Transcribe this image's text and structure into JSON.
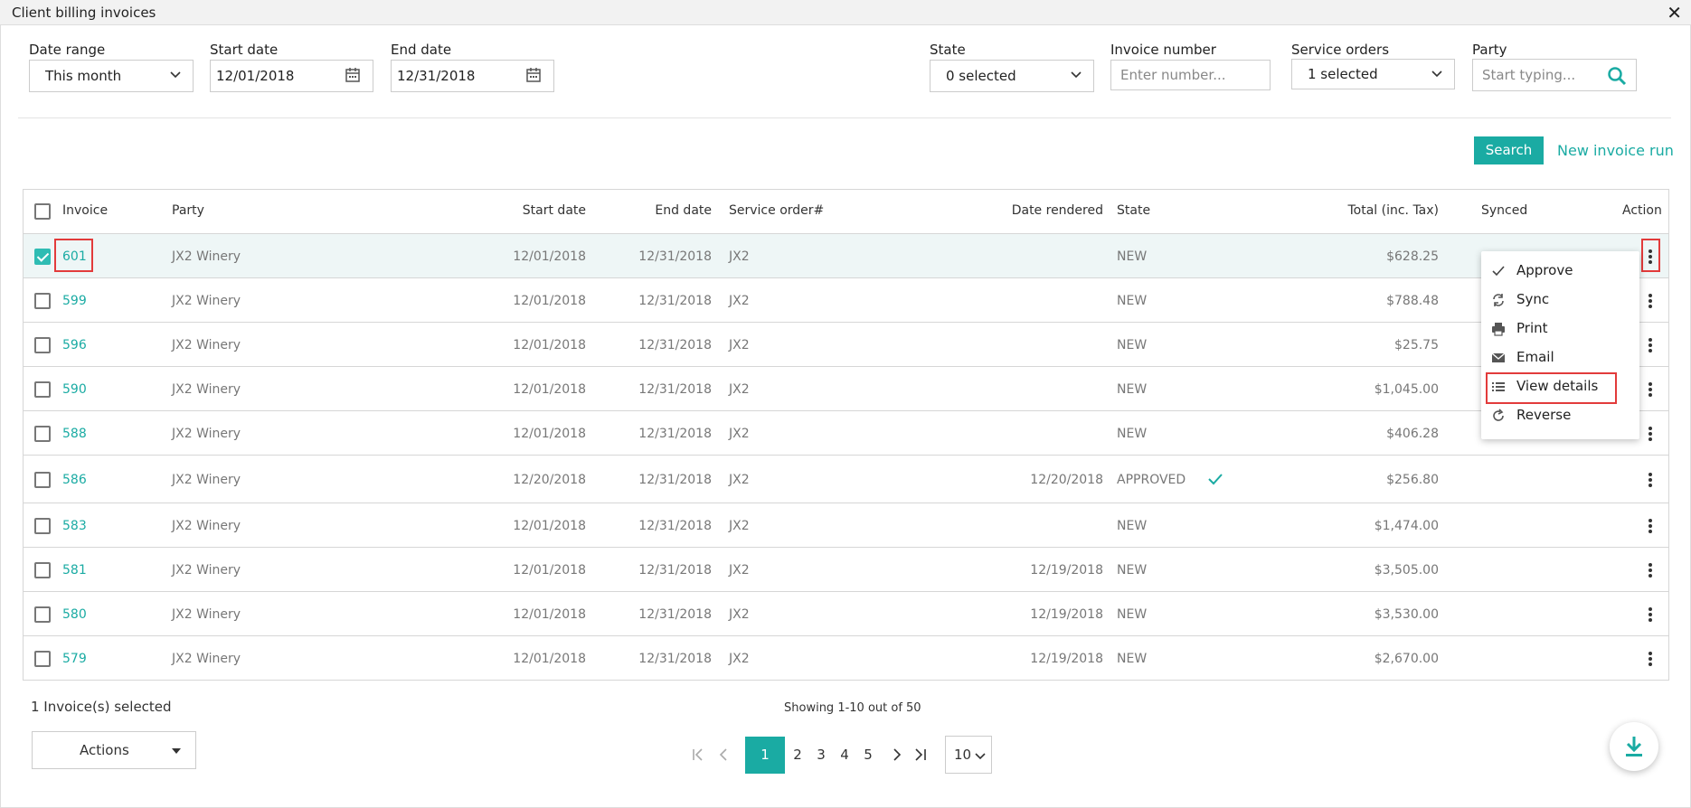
{
  "window": {
    "title": "Client billing invoices"
  },
  "filters": {
    "date_range": {
      "label": "Date range",
      "value": "This month"
    },
    "start_date": {
      "label": "Start date",
      "value": "12/01/2018"
    },
    "end_date": {
      "label": "End date",
      "value": "12/31/2018"
    },
    "state": {
      "label": "State",
      "value": "0 selected"
    },
    "invoice_number": {
      "label": "Invoice number",
      "placeholder": "Enter number..."
    },
    "service_orders": {
      "label": "Service orders",
      "value": "1 selected"
    },
    "party": {
      "label": "Party",
      "placeholder": "Start typing..."
    }
  },
  "toolbar": {
    "search_label": "Search",
    "new_run_label": "New invoice run"
  },
  "table": {
    "headers": {
      "invoice": "Invoice",
      "party": "Party",
      "start_date": "Start date",
      "end_date": "End date",
      "service_order": "Service order#",
      "date_rendered": "Date rendered",
      "state": "State",
      "total": "Total (inc. Tax)",
      "synced": "Synced",
      "action": "Action"
    },
    "rows": [
      {
        "invoice": "601",
        "party": "JX2 Winery",
        "start": "12/01/2018",
        "end": "12/31/2018",
        "so": "JX2",
        "rendered": "",
        "state": "NEW",
        "total": "$628.25",
        "checked": true
      },
      {
        "invoice": "599",
        "party": "JX2 Winery",
        "start": "12/01/2018",
        "end": "12/31/2018",
        "so": "JX2",
        "rendered": "",
        "state": "NEW",
        "total": "$788.48",
        "checked": false
      },
      {
        "invoice": "596",
        "party": "JX2 Winery",
        "start": "12/01/2018",
        "end": "12/31/2018",
        "so": "JX2",
        "rendered": "",
        "state": "NEW",
        "total": "$25.75",
        "checked": false
      },
      {
        "invoice": "590",
        "party": "JX2 Winery",
        "start": "12/01/2018",
        "end": "12/31/2018",
        "so": "JX2",
        "rendered": "",
        "state": "NEW",
        "total": "$1,045.00",
        "checked": false
      },
      {
        "invoice": "588",
        "party": "JX2 Winery",
        "start": "12/01/2018",
        "end": "12/31/2018",
        "so": "JX2",
        "rendered": "",
        "state": "NEW",
        "total": "$406.28",
        "checked": false
      },
      {
        "invoice": "586",
        "party": "JX2 Winery",
        "start": "12/20/2018",
        "end": "12/31/2018",
        "so": "JX2",
        "rendered": "12/20/2018",
        "state": "APPROVED",
        "total": "$256.80",
        "checked": false,
        "state_check": true
      },
      {
        "invoice": "583",
        "party": "JX2 Winery",
        "start": "12/01/2018",
        "end": "12/31/2018",
        "so": "JX2",
        "rendered": "",
        "state": "NEW",
        "total": "$1,474.00",
        "checked": false
      },
      {
        "invoice": "581",
        "party": "JX2 Winery",
        "start": "12/01/2018",
        "end": "12/31/2018",
        "so": "JX2",
        "rendered": "12/19/2018",
        "state": "NEW",
        "total": "$3,505.00",
        "checked": false
      },
      {
        "invoice": "580",
        "party": "JX2 Winery",
        "start": "12/01/2018",
        "end": "12/31/2018",
        "so": "JX2",
        "rendered": "12/19/2018",
        "state": "NEW",
        "total": "$3,530.00",
        "checked": false
      },
      {
        "invoice": "579",
        "party": "JX2 Winery",
        "start": "12/01/2018",
        "end": "12/31/2018",
        "so": "JX2",
        "rendered": "12/19/2018",
        "state": "NEW",
        "total": "$2,670.00",
        "checked": false
      }
    ]
  },
  "action_menu": {
    "items": [
      {
        "label": "Approve",
        "icon": "check-icon"
      },
      {
        "label": "Sync",
        "icon": "sync-icon"
      },
      {
        "label": "Print",
        "icon": "print-icon"
      },
      {
        "label": "Email",
        "icon": "email-icon"
      },
      {
        "label": "View details",
        "icon": "list-icon"
      },
      {
        "label": "Reverse",
        "icon": "reverse-icon"
      }
    ]
  },
  "footer": {
    "selected_text": "1 Invoice(s) selected",
    "showing_text": "Showing 1-10 out of 50",
    "actions_label": "Actions",
    "pages": [
      "1",
      "2",
      "3",
      "4",
      "5"
    ],
    "current_page": "1",
    "page_size": "10"
  },
  "colors": {
    "accent": "#1aaba3",
    "highlight": "#e23b3b"
  }
}
